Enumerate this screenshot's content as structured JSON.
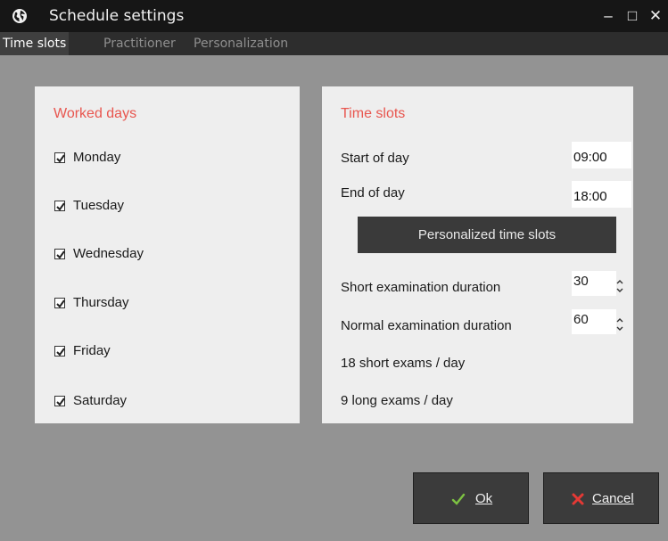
{
  "window": {
    "title": "Schedule settings",
    "minimize_glyph": "–",
    "maximize_glyph": "□",
    "close_glyph": "✕"
  },
  "tabs": [
    {
      "label": "Time slots",
      "active": true
    },
    {
      "label": "Practitioner",
      "active": false
    },
    {
      "label": "Personalization",
      "active": false
    }
  ],
  "worked_days": {
    "heading": "Worked days",
    "days": [
      {
        "label": "Monday",
        "checked": true
      },
      {
        "label": "Tuesday",
        "checked": true
      },
      {
        "label": "Wednesday",
        "checked": true
      },
      {
        "label": "Thursday",
        "checked": true
      },
      {
        "label": "Friday",
        "checked": true
      },
      {
        "label": "Saturday",
        "checked": true
      }
    ]
  },
  "time_slots": {
    "heading": "Time slots",
    "start_label": "Start of day",
    "start_value": "09:00",
    "end_label": "End of day",
    "end_value": "18:00",
    "personalized_button": "Personalized time slots",
    "short_label": "Short examination duration",
    "short_value": "30",
    "normal_label": "Normal examination duration",
    "normal_value": "60",
    "short_summary": "18 short exams / day",
    "long_summary": "9 long exams / day"
  },
  "actions": {
    "ok_label": "Ok",
    "cancel_label": "Cancel"
  },
  "colors": {
    "accent_heading": "#e8554e",
    "ok_icon": "#7dc242",
    "cancel_icon": "#e53935"
  },
  "icons": {
    "app": "globe-icon",
    "ok": "checkmark-icon",
    "cancel": "cross-icon"
  }
}
